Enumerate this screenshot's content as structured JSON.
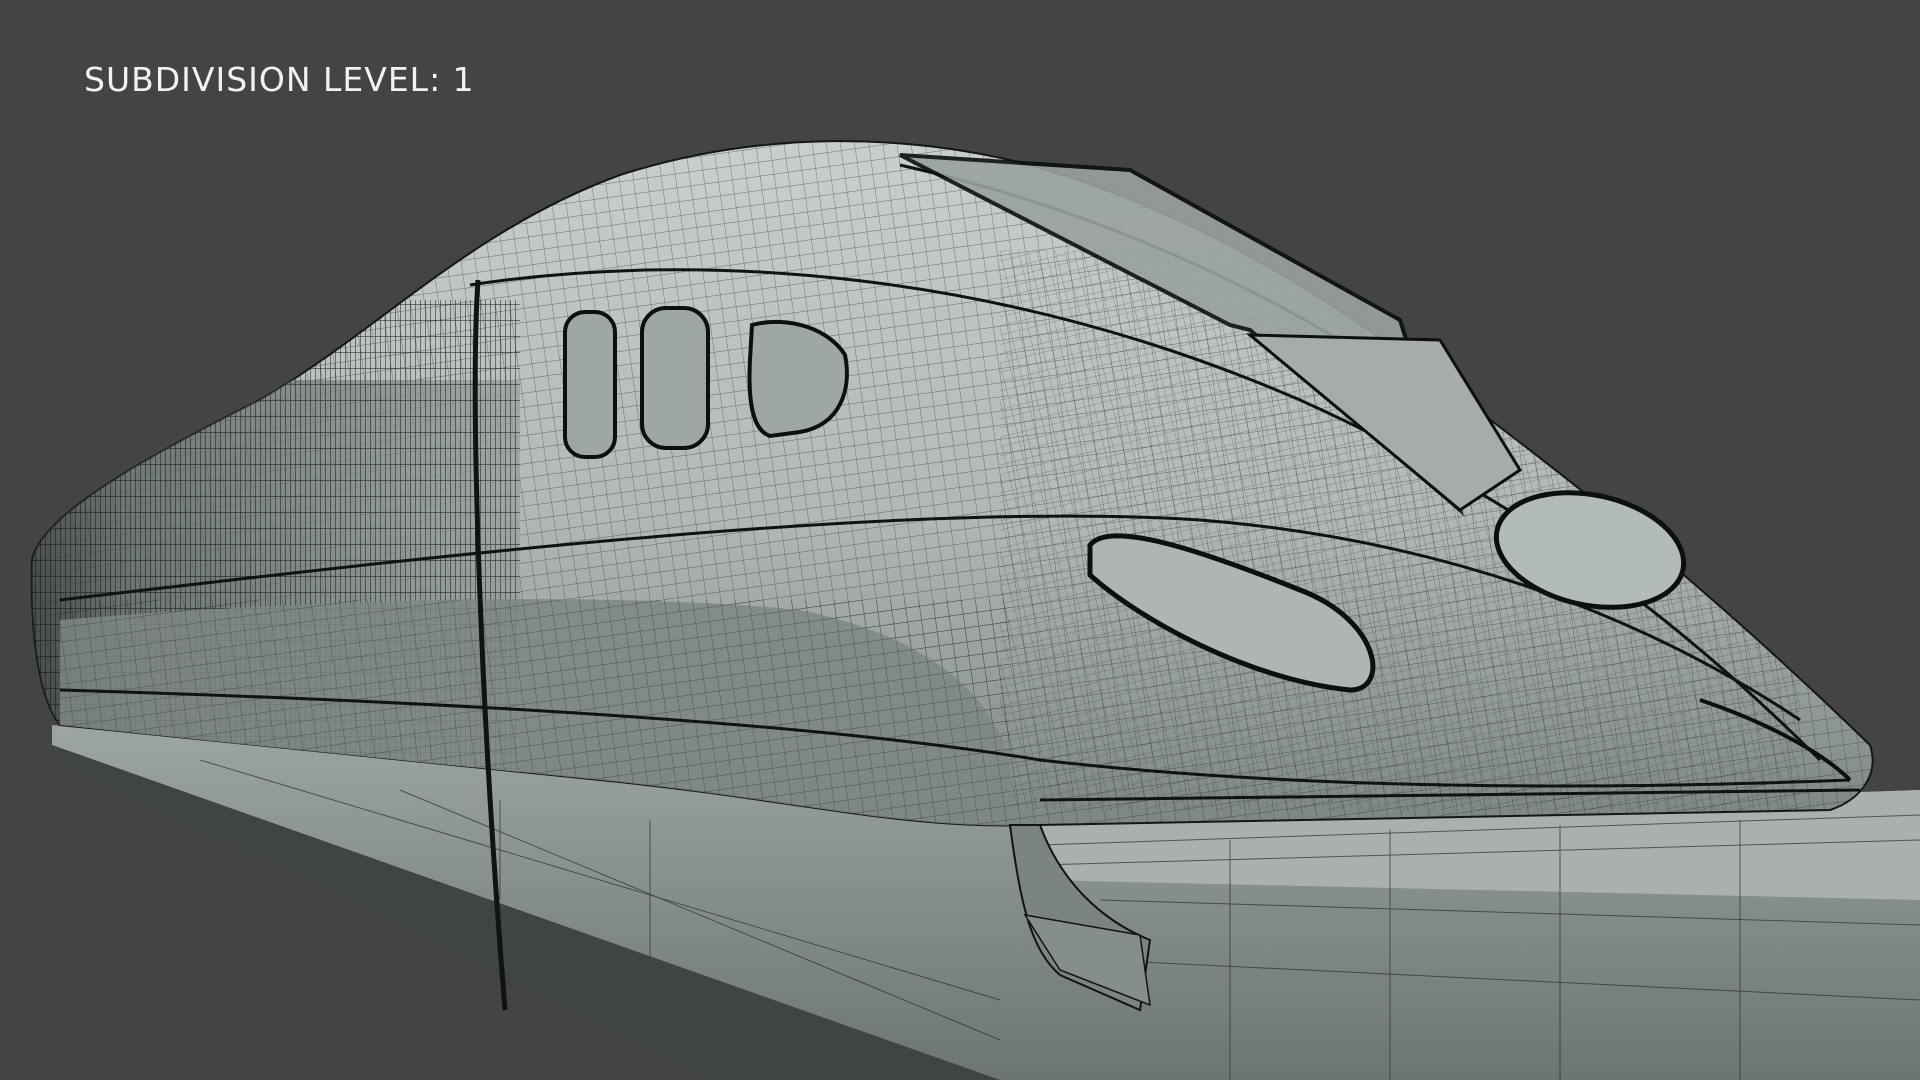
{
  "viewport": {
    "overlay_text": "SUBDIVISION LEVEL: 1",
    "background_color": "#444444",
    "model": "high-speed train nose wireframe render",
    "colors": {
      "surface": "#b9c0bf",
      "surface_shadow": "#6f7776",
      "wire": "#1e2222",
      "track": "#9ea5a4",
      "track_side": "#5f6665"
    }
  }
}
